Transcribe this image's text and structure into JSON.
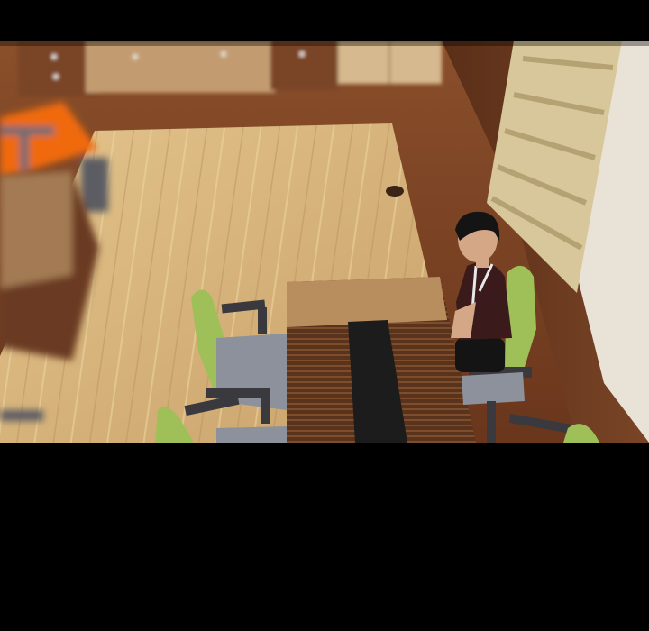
{
  "scene": {
    "colors": {
      "background": "#000000",
      "floor_wood": "#7a4526",
      "rug": "#d9b97f",
      "cabinet": "#b48a62",
      "wall_panel": "#6b3a22",
      "blind": "#d8c79a",
      "chair_green": "#9fbf58",
      "chair_seat": "#8c919c",
      "table_top": "#b88e5e",
      "table_runner": "#1c1c1c",
      "orange_item": "#f06a10",
      "person_shirt": "#3a1a1a",
      "person_hair": "#141414"
    },
    "icons": [
      "chair-icon",
      "table-icon",
      "person-figure",
      "desk-icon",
      "window-blind-icon",
      "cabinet-icon"
    ]
  }
}
